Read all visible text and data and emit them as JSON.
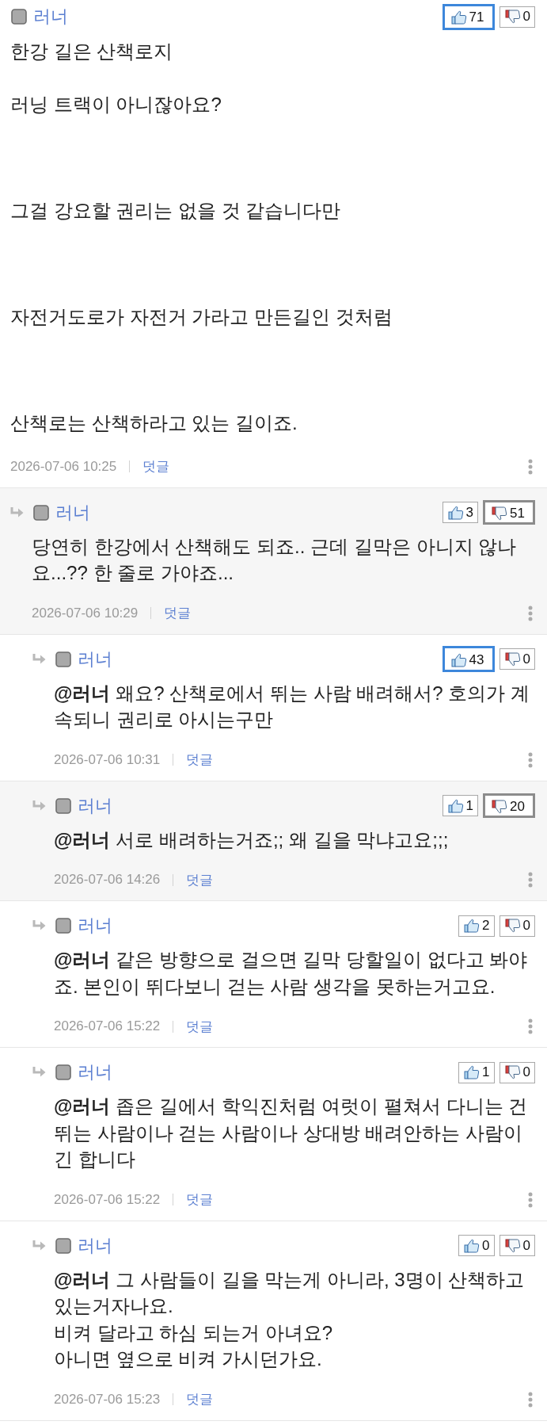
{
  "comments": [
    {
      "author": "러너",
      "like": {
        "count": "71",
        "highlighted": true
      },
      "dislike": {
        "count": "0",
        "highlighted": false
      },
      "body": "한강 길은 산책로지\n\n러닝 트랙이 아니잖아요?\n\n\n\n그걸 강요할 권리는 없을 것 같습니다만\n\n\n\n자전거도로가 자전거 가라고 만든길인 것처럼\n\n\n\n산책로는 산책하라고 있는 길이죠.",
      "date": "2026-07-06 10:25",
      "reply_link": "덧글",
      "children": [
        {
          "author": "러너",
          "like": {
            "count": "3",
            "highlighted": false
          },
          "dislike": {
            "count": "51",
            "highlighted": true
          },
          "body": "당연히 한강에서 산책해도 되죠.. 근데 길막은 아니지 않나요...?? 한 줄로 가야죠...",
          "date": "2026-07-06 10:29",
          "reply_link": "덧글",
          "children": [
            {
              "author": "러너",
              "like": {
                "count": "43",
                "highlighted": true
              },
              "dislike": {
                "count": "0",
                "highlighted": false
              },
              "body": "**@러너** 왜요? 산책로에서 뛰는 사람 배려해서? 호의가 계속되니 권리로 아시는구만",
              "date": "2026-07-06 10:31",
              "reply_link": "덧글"
            },
            {
              "author": "러너",
              "like": {
                "count": "1",
                "highlighted": false
              },
              "dislike": {
                "count": "20",
                "highlighted": true
              },
              "body": "**@러너** 서로 배려하는거죠;; 왜 길을 막냐고요;;;",
              "date": "2026-07-06 14:26",
              "reply_link": "덧글"
            },
            {
              "author": "러너",
              "like": {
                "count": "2",
                "highlighted": false
              },
              "dislike": {
                "count": "0",
                "highlighted": false
              },
              "body": "**@러너** 같은 방향으로 걸으면 길막 당할일이 없다고 봐야죠. 본인이 뛰다보니 걷는 사람 생각을 못하는거고요.",
              "date": "2026-07-06 15:22",
              "reply_link": "덧글"
            },
            {
              "author": "러너",
              "like": {
                "count": "1",
                "highlighted": false
              },
              "dislike": {
                "count": "0",
                "highlighted": false
              },
              "body": "**@러너** 좁은 길에서 학익진처럼 여럿이 펼쳐서 다니는 건 뛰는 사람이나 걷는 사람이나 상대방 배려안하는 사람이 긴 합니다",
              "date": "2026-07-06 15:22",
              "reply_link": "덧글"
            },
            {
              "author": "러너",
              "like": {
                "count": "0",
                "highlighted": false
              },
              "dislike": {
                "count": "0",
                "highlighted": false
              },
              "body": "**@러너** 그 사람들이 길을 막는게 아니라, 3명이 산책하고 있는거자나요.\n비켜 달라고 하심 되는거 아녀요?\n아니면 옆으로 비켜 가시던가요.",
              "date": "2026-07-06 15:23",
              "reply_link": "덧글"
            }
          ]
        }
      ]
    }
  ]
}
